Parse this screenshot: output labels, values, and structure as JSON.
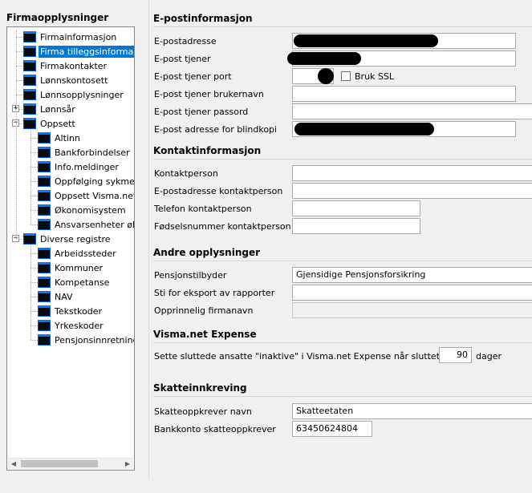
{
  "left": {
    "title": "Firmaopplysninger",
    "tree": [
      {
        "label": "Firmainformasjon",
        "level": 0,
        "selected": false
      },
      {
        "label": "Firma tilleggsinformasjon",
        "level": 0,
        "selected": true
      },
      {
        "label": "Firmakontakter",
        "level": 0,
        "selected": false
      },
      {
        "label": "Lønnskontosett",
        "level": 0,
        "selected": false
      },
      {
        "label": "Lønnsopplysninger",
        "level": 0,
        "selected": false
      },
      {
        "label": "Lønnsår",
        "level": 0,
        "expander": "+",
        "selected": false
      },
      {
        "label": "Oppsett",
        "level": 0,
        "expander": "−",
        "selected": false
      },
      {
        "label": "Altinn",
        "level": 1,
        "selected": false
      },
      {
        "label": "Bankforbindelser",
        "level": 1,
        "selected": false
      },
      {
        "label": "Info.meldinger",
        "level": 1,
        "selected": false
      },
      {
        "label": "Oppfølging sykmeldte",
        "level": 1,
        "selected": false
      },
      {
        "label": "Oppsett Visma.net",
        "level": 1,
        "selected": false
      },
      {
        "label": "Økonomisystem",
        "level": 1,
        "selected": false
      },
      {
        "label": "Ansvarsenheter økonomi",
        "level": 1,
        "selected": false
      },
      {
        "label": "Diverse registre",
        "level": 0,
        "expander": "−",
        "selected": false
      },
      {
        "label": "Arbeidssteder",
        "level": 1,
        "selected": false
      },
      {
        "label": "Kommuner",
        "level": 1,
        "selected": false
      },
      {
        "label": "Kompetanse",
        "level": 1,
        "selected": false
      },
      {
        "label": "NAV",
        "level": 1,
        "selected": false
      },
      {
        "label": "Tekstkoder",
        "level": 1,
        "selected": false
      },
      {
        "label": "Yrkeskoder",
        "level": 1,
        "selected": false
      },
      {
        "label": "Pensjonsinnretninger",
        "level": 1,
        "selected": false
      }
    ],
    "scroll_left": "◀",
    "scroll_right": "▶"
  },
  "email": {
    "title": "E-postinformasjon",
    "address_label": "E-postadresse",
    "server_label": "E-post tjener",
    "port_label": "E-post tjener port",
    "ssl_label": "Bruk SSL",
    "username_label": "E-post tjener brukernavn",
    "username_value": "",
    "password_label": "E-post tjener passord",
    "password_value": "",
    "bcc_label": "E-post adresse for blindkopi"
  },
  "contact": {
    "title": "Kontaktinformasjon",
    "person_label": "Kontaktperson",
    "person_value": "",
    "email_label": "E-postadresse kontaktperson",
    "email_value": "",
    "phone_label": "Telefon kontaktperson",
    "phone_value": "",
    "birthno_label": "Fødselsnummer kontaktperson",
    "birthno_value": ""
  },
  "other": {
    "title": "Andre opplysninger",
    "pension_label": "Pensjonstilbyder",
    "pension_value": "Gjensidige Pensjonsforsikring",
    "export_label": "Sti for eksport av rapporter",
    "export_value": "",
    "orig_label": "Opprinnelig firmanavn",
    "orig_value": ""
  },
  "expense": {
    "title": "Visma.net Expense",
    "text": "Sette sluttede ansatte \"inaktive\"  i Visma.net Expense når sluttet siste",
    "days_value": "90",
    "days_unit": "dager"
  },
  "tax": {
    "title": "Skatteinnkreving",
    "name_label": "Skatteoppkrever navn",
    "name_value": "Skatteetaten",
    "account_label": "Bankkonto skatteoppkrever",
    "account_value": "63450624804"
  }
}
